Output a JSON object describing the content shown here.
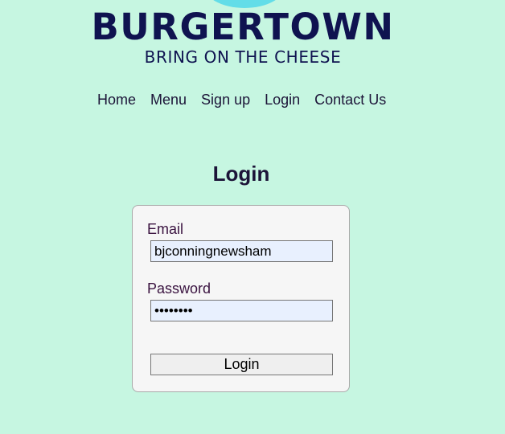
{
  "brand": {
    "name": "BURGERTOWN",
    "tagline": "BRING ON THE CHEESE"
  },
  "nav": {
    "items": [
      {
        "label": "Home"
      },
      {
        "label": "Menu"
      },
      {
        "label": "Sign up"
      },
      {
        "label": "Login"
      },
      {
        "label": "Contact Us"
      }
    ]
  },
  "page": {
    "title": "Login"
  },
  "form": {
    "email_label": "Email",
    "email_value": "bjconningnewsham",
    "password_label": "Password",
    "password_value": "••••••••",
    "submit_label": "Login"
  },
  "colors": {
    "background": "#c6f6e1",
    "brand": "#0f1350",
    "logo_accent": "#63dde8",
    "card_background": "#f6f6f6",
    "input_background": "#e8f0fe"
  }
}
